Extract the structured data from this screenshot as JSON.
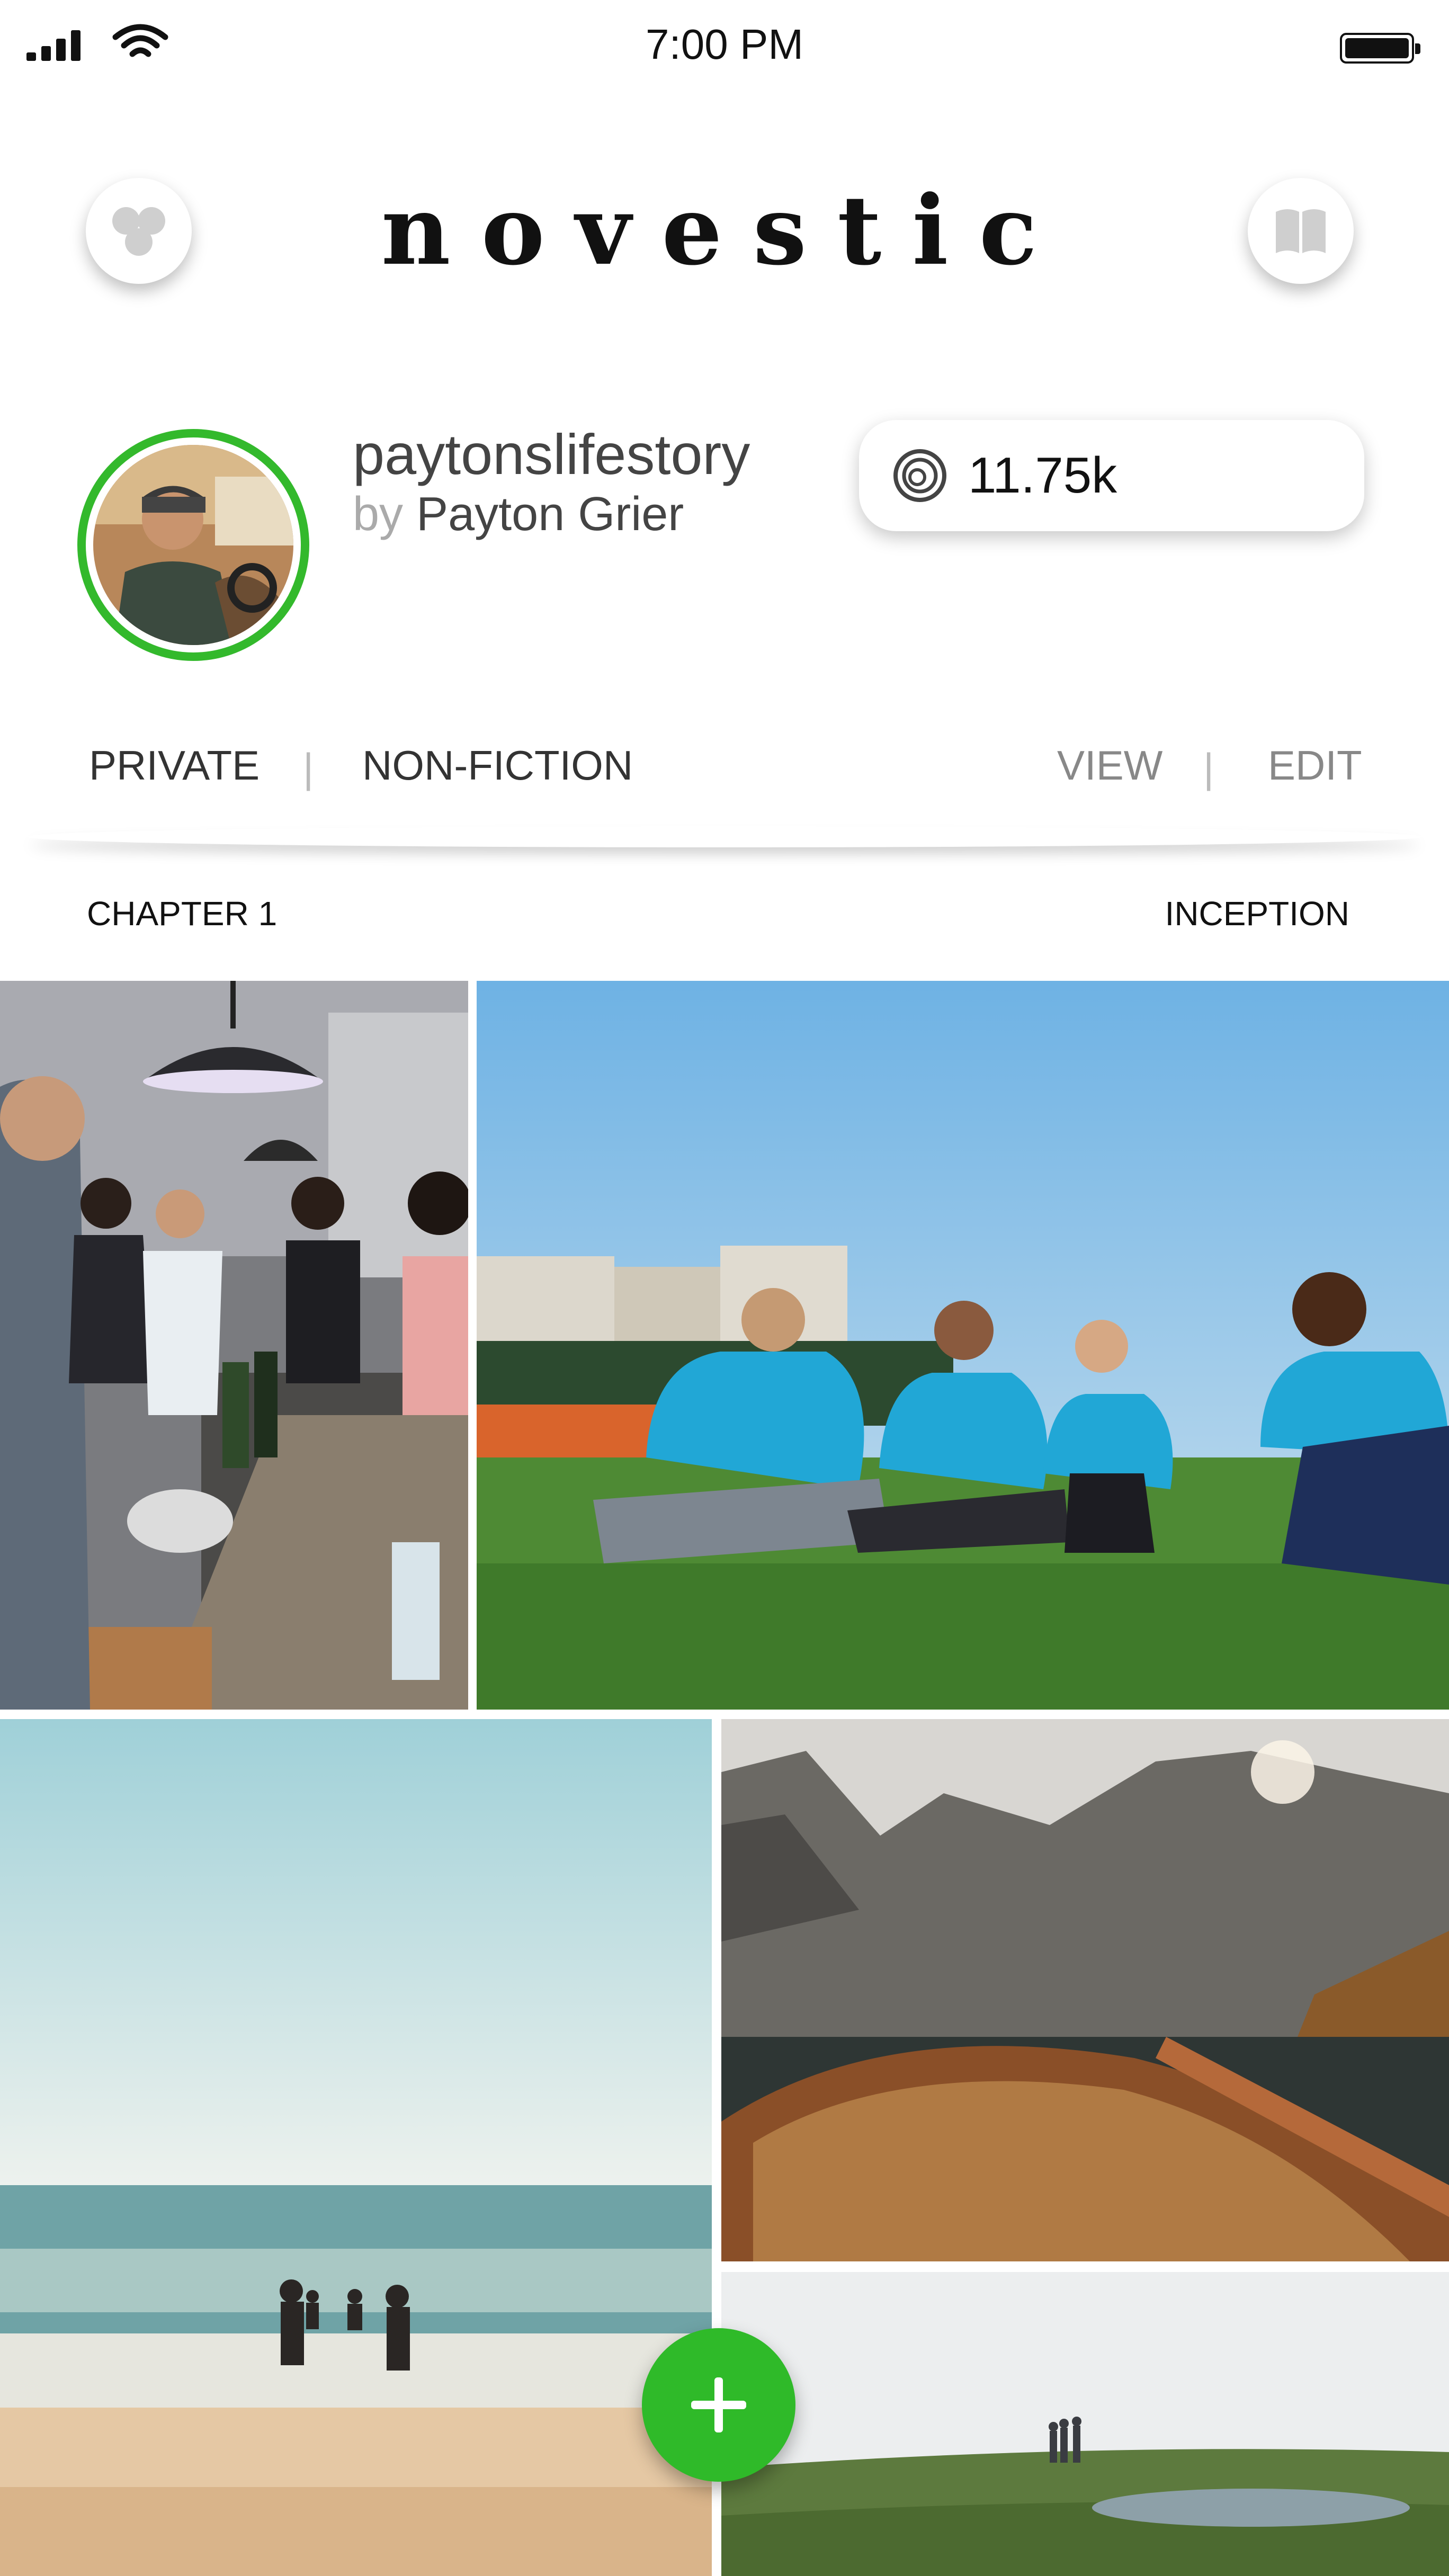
{
  "status_bar": {
    "time": "7:00 PM"
  },
  "header": {
    "app_name": "novestic",
    "left_icon": "community-icon",
    "right_icon": "book-icon"
  },
  "profile": {
    "username": "paytonslifestory",
    "by_label": "by",
    "author_name": "Payton Grier",
    "stat_icon": "coin-icon",
    "stat_value": "11.75k",
    "accent_color": "#33b92c"
  },
  "tabs": {
    "privacy": "PRIVATE",
    "separator": "|",
    "genre": "NON-FICTION",
    "view": "VIEW",
    "edit": "EDIT"
  },
  "chapter": {
    "number_label": "CHAPTER 1",
    "title": "INCEPTION"
  },
  "photos": [
    {
      "subject": "kitchen-party"
    },
    {
      "subject": "volunteers-on-grass"
    },
    {
      "subject": "beach-waves"
    },
    {
      "subject": "lake-boat-mountains"
    },
    {
      "subject": "hill-lake-people"
    }
  ],
  "fab": {
    "icon": "plus-icon",
    "color": "#2fba29"
  }
}
